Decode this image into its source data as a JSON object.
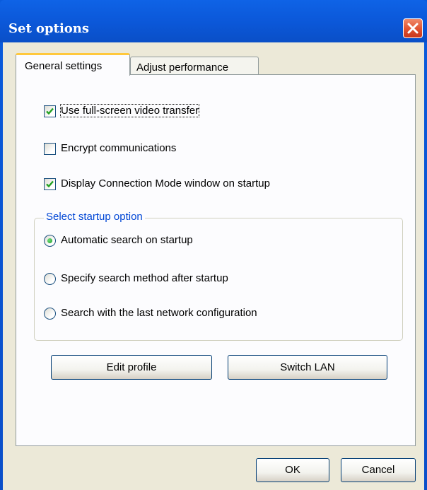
{
  "window": {
    "title": "Set options",
    "close_icon": "close-x-icon",
    "colors": {
      "titlebar": "#0b57d8",
      "close": "#e0512f",
      "face": "#ece9d8",
      "group_title": "#0046d5"
    }
  },
  "tabs": [
    {
      "label": "General settings",
      "selected": true
    },
    {
      "label": "Adjust performance",
      "selected": false
    }
  ],
  "checkboxes": [
    {
      "label": "Use full-screen video transfer",
      "checked": true
    },
    {
      "label": "Encrypt communications",
      "checked": false
    },
    {
      "label": "Display Connection Mode window on startup",
      "checked": true
    }
  ],
  "startup_group": {
    "title": "Select startup option",
    "options": [
      {
        "label": "Automatic search on startup",
        "selected": true
      },
      {
        "label": "Specify search method after startup",
        "selected": false
      },
      {
        "label": "Search with the last network configuration",
        "selected": false
      }
    ]
  },
  "buttons": {
    "edit_profile": "Edit profile",
    "switch_lan": "Switch LAN",
    "ok": "OK",
    "cancel": "Cancel"
  }
}
